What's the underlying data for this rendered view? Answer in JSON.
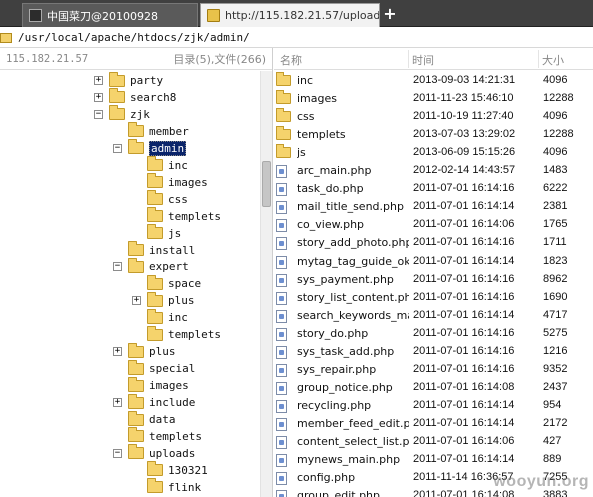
{
  "tabs": [
    {
      "label": "中国菜刀@20100928",
      "icon": "terminal-icon",
      "active": false
    },
    {
      "label": "http://115.182.21.57/uploads...",
      "icon": "folder-icon",
      "active": true
    }
  ],
  "new_tab_label": "+",
  "path": "/usr/local/apache/htdocs/zjk/admin/",
  "left_pane": {
    "ip": "115.182.21.57",
    "summary": "目录(5),文件(266)"
  },
  "tree": [
    {
      "label": "party",
      "expander": "+"
    },
    {
      "label": "search8",
      "expander": "+"
    },
    {
      "label": "zjk",
      "expander": "−"
    },
    {
      "label": "member",
      "expander": ""
    },
    {
      "label": "admin",
      "expander": "−",
      "selected": true
    },
    {
      "label": "inc",
      "expander": ""
    },
    {
      "label": "images",
      "expander": ""
    },
    {
      "label": "css",
      "expander": ""
    },
    {
      "label": "templets",
      "expander": ""
    },
    {
      "label": "js",
      "expander": ""
    },
    {
      "label": "install",
      "expander": ""
    },
    {
      "label": "expert",
      "expander": "−"
    },
    {
      "label": "space",
      "expander": ""
    },
    {
      "label": "plus",
      "expander": "+"
    },
    {
      "label": "inc",
      "expander": ""
    },
    {
      "label": "templets",
      "expander": ""
    },
    {
      "label": "plus",
      "expander": "+"
    },
    {
      "label": "special",
      "expander": ""
    },
    {
      "label": "images",
      "expander": ""
    },
    {
      "label": "include",
      "expander": "+"
    },
    {
      "label": "data",
      "expander": ""
    },
    {
      "label": "templets",
      "expander": ""
    },
    {
      "label": "uploads",
      "expander": "−"
    },
    {
      "label": "130321",
      "expander": ""
    },
    {
      "label": "flink",
      "expander": ""
    }
  ],
  "columns": {
    "name": "名称",
    "time": "时间",
    "size": "大小"
  },
  "files": [
    {
      "type": "folder",
      "name": "inc",
      "time": "2013-09-03 14:21:31",
      "size": "4096"
    },
    {
      "type": "folder",
      "name": "images",
      "time": "2011-11-23 15:46:10",
      "size": "12288"
    },
    {
      "type": "folder",
      "name": "css",
      "time": "2011-10-19 11:27:40",
      "size": "4096"
    },
    {
      "type": "folder",
      "name": "templets",
      "time": "2013-07-03 13:29:02",
      "size": "12288"
    },
    {
      "type": "folder",
      "name": "js",
      "time": "2013-06-09 15:15:26",
      "size": "4096"
    },
    {
      "type": "file",
      "name": "arc_main.php",
      "time": "2012-02-14 14:43:57",
      "size": "1483"
    },
    {
      "type": "file",
      "name": "task_do.php",
      "time": "2011-07-01 16:14:16",
      "size": "6222"
    },
    {
      "type": "file",
      "name": "mail_title_send.php",
      "time": "2011-07-01 16:14:14",
      "size": "2381"
    },
    {
      "type": "file",
      "name": "co_view.php",
      "time": "2011-07-01 16:14:06",
      "size": "1765"
    },
    {
      "type": "file",
      "name": "story_add_photo.php",
      "time": "2011-07-01 16:14:16",
      "size": "1711"
    },
    {
      "type": "file",
      "name": "mytag_tag_guide_ok....",
      "time": "2011-07-01 16:14:14",
      "size": "1823"
    },
    {
      "type": "file",
      "name": "sys_payment.php",
      "time": "2011-07-01 16:14:16",
      "size": "8962"
    },
    {
      "type": "file",
      "name": "story_list_content.php",
      "time": "2011-07-01 16:14:16",
      "size": "1690"
    },
    {
      "type": "file",
      "name": "search_keywords_ma...",
      "time": "2011-07-01 16:14:14",
      "size": "4717"
    },
    {
      "type": "file",
      "name": "story_do.php",
      "time": "2011-07-01 16:14:16",
      "size": "5275"
    },
    {
      "type": "file",
      "name": "sys_task_add.php",
      "time": "2011-07-01 16:14:16",
      "size": "1216"
    },
    {
      "type": "file",
      "name": "sys_repair.php",
      "time": "2011-07-01 16:14:16",
      "size": "9352"
    },
    {
      "type": "file",
      "name": "group_notice.php",
      "time": "2011-07-01 16:14:08",
      "size": "2437"
    },
    {
      "type": "file",
      "name": "recycling.php",
      "time": "2011-07-01 16:14:14",
      "size": "954"
    },
    {
      "type": "file",
      "name": "member_feed_edit.php",
      "time": "2011-07-01 16:14:14",
      "size": "2172"
    },
    {
      "type": "file",
      "name": "content_select_list.php",
      "time": "2011-07-01 16:14:06",
      "size": "427"
    },
    {
      "type": "file",
      "name": "mynews_main.php",
      "time": "2011-07-01 16:14:14",
      "size": "889"
    },
    {
      "type": "file",
      "name": "config.php",
      "time": "2011-11-14 16:36:57",
      "size": "7255"
    },
    {
      "type": "file",
      "name": "group_edit.php",
      "time": "2011-07-01 16:14:08",
      "size": "3883"
    }
  ],
  "watermark": "wooyun.org"
}
